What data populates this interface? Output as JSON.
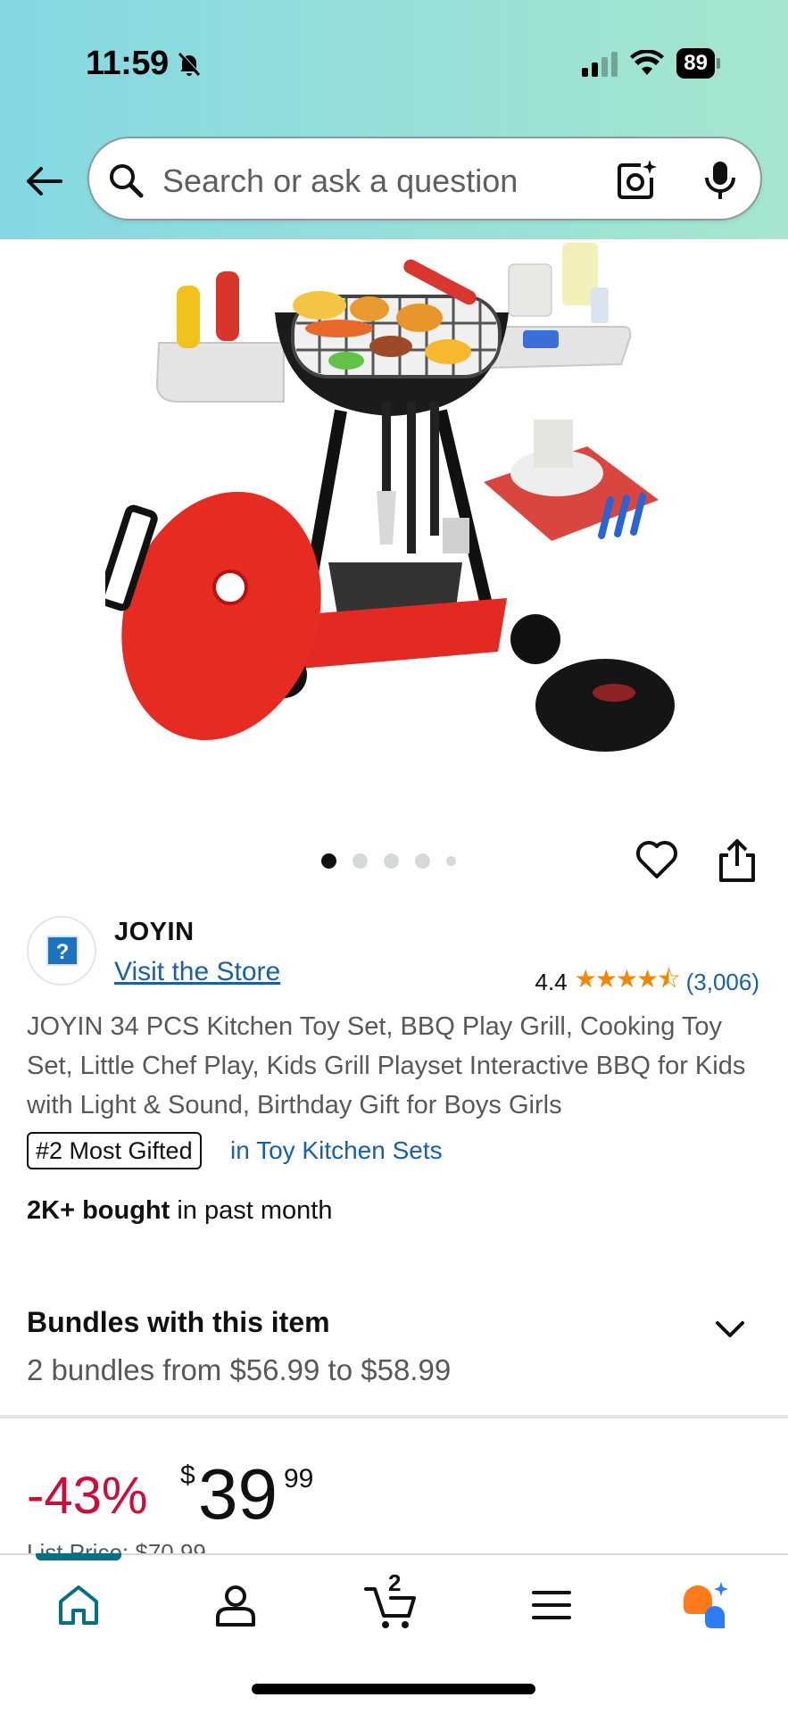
{
  "status_bar": {
    "time": "11:59",
    "battery": "89"
  },
  "search": {
    "placeholder": "Search or ask a question"
  },
  "carousel": {
    "total_dots": 5,
    "active_index": 0
  },
  "brand": {
    "logo_glyph": "?",
    "name": "JOYIN",
    "visit_store": "Visit the Store"
  },
  "rating": {
    "value": "4.4",
    "stars": "★★★★⯪",
    "count": "(3,006)"
  },
  "product": {
    "title": "JOYIN 34 PCS Kitchen Toy Set, BBQ Play Grill, Cooking Toy Set, Little Chef Play, Kids Grill Playset Interactive BBQ for Kids with Light & Sound, Birthday Gift for Boys Girls",
    "badge": "#2 Most Gifted",
    "badge_category": "in Toy Kitchen Sets",
    "bought_bold": "2K+ bought",
    "bought_rest": " in past month"
  },
  "bundles": {
    "title": "Bundles with this item",
    "subtitle": "2 bundles from $56.99 to $58.99"
  },
  "price": {
    "discount": "-43%",
    "symbol": "$",
    "whole": "39",
    "fraction": "99",
    "list_price_partial": "List Price: $70.99"
  },
  "bottom_nav": {
    "cart_count": "2",
    "items": [
      "home-icon",
      "account-icon",
      "cart-icon",
      "menu-icon",
      "rufus-icon"
    ]
  },
  "colors": {
    "header_gradient_start": "#84d8e3",
    "header_gradient_end": "#a6e6ce",
    "link": "#1a5fa8",
    "discount": "#cc0c39",
    "star": "#f08804",
    "nav_active": "#007185",
    "rufus_orange": "#ff7a1a",
    "rufus_blue": "#2e7bf6"
  }
}
